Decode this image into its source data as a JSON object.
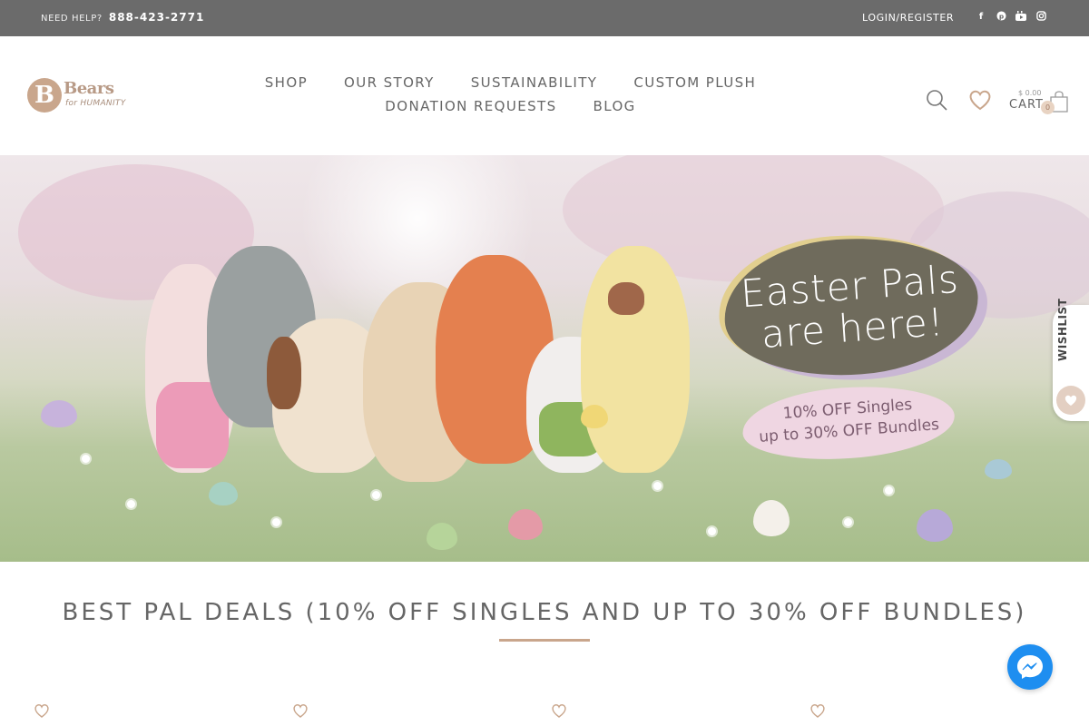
{
  "topbar": {
    "help_label": "NEED HELP?",
    "phone": "888-423-2771",
    "login": "LOGIN/REGISTER",
    "socials": [
      "facebook-icon",
      "pinterest-icon",
      "youtube-icon",
      "instagram-icon"
    ]
  },
  "logo": {
    "brand": "Bears",
    "sub": "for HUMANITY",
    "mark": "B"
  },
  "nav": {
    "row1": [
      "SHOP",
      "OUR STORY",
      "SUSTAINABILITY",
      "CUSTOM PLUSH"
    ],
    "row2": [
      "DONATION REQUESTS",
      "BLOG"
    ]
  },
  "cart": {
    "amount": "$ 0.00",
    "label": "CART",
    "count": "0"
  },
  "hero": {
    "headline_line1": "Easter Pals",
    "headline_line2": "are here!",
    "promo_line1": "10% OFF Singles",
    "promo_line2": "up to 30% OFF Bundles"
  },
  "wishlist_tab": {
    "label": "WISHLIST"
  },
  "deals": {
    "title": "BEST PAL DEALS (10% OFF SINGLES AND UP TO 30% OFF BUNDLES)"
  },
  "colors": {
    "topbar": "#6b6b6b",
    "accent": "#c9a68c",
    "messenger": "#1e8ef0"
  }
}
